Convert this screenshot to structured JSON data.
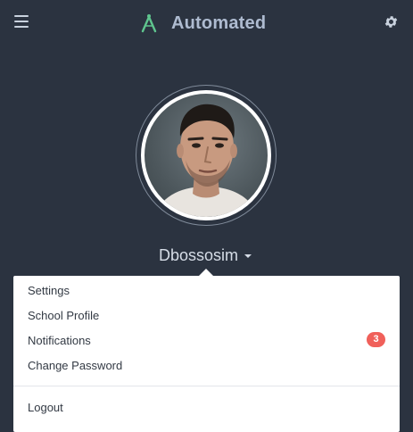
{
  "header": {
    "app_title": "Automated",
    "menu_icon": "hamburger-menu-icon",
    "logo_icon": "compass-logo-icon",
    "settings_icon": "gear-icon",
    "brand_color": "#aebbd0",
    "logo_color": "#5fc58e"
  },
  "profile": {
    "avatar": "user-avatar-photo",
    "username": "Dbossosim",
    "caret_icon": "caret-down-icon"
  },
  "dropdown": {
    "items": [
      {
        "label": "Settings"
      },
      {
        "label": "School Profile"
      },
      {
        "label": "Notifications",
        "badge": "3"
      },
      {
        "label": "Change Password"
      }
    ],
    "logout": {
      "label": "Logout"
    },
    "badge_color": "#f0605a"
  }
}
